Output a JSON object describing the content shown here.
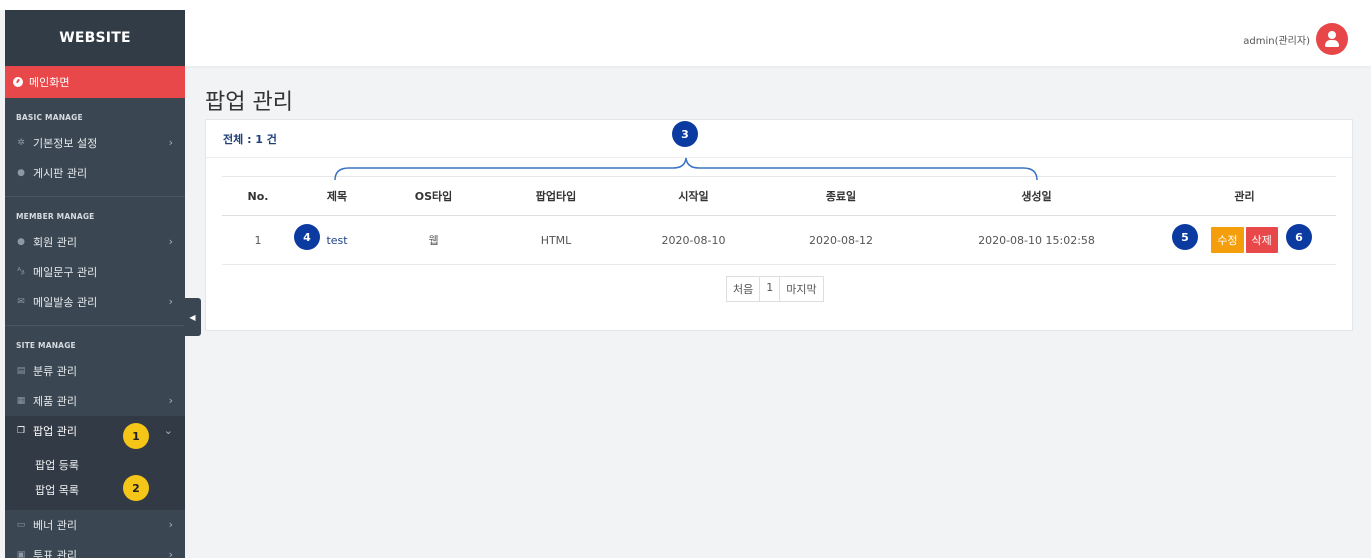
{
  "brand": "WEBSITE",
  "sidebar": {
    "home": "메인화면",
    "sections": [
      {
        "title": "BASIC MANAGE",
        "items": [
          {
            "label": "기본정보 설정",
            "icon": "gear-icon",
            "has_children": true
          },
          {
            "label": "게시판 관리",
            "icon": "chat-icon",
            "has_children": false
          }
        ]
      },
      {
        "title": "MEMBER MANAGE",
        "items": [
          {
            "label": "회원 관리",
            "icon": "user-icon",
            "has_children": true
          },
          {
            "label": "메일문구 관리",
            "icon": "spellcheck-icon",
            "has_children": false
          },
          {
            "label": "메일발송 관리",
            "icon": "envelope-icon",
            "has_children": true
          }
        ]
      },
      {
        "title": "SITE MANAGE",
        "items": [
          {
            "label": "분류 관리",
            "icon": "list-icon",
            "has_children": false
          },
          {
            "label": "제품 관리",
            "icon": "box-icon",
            "has_children": true
          },
          {
            "label": "팝업 관리",
            "icon": "window-icon",
            "has_children": true,
            "active": true,
            "children": [
              "팝업 등록",
              "팝업 목록"
            ]
          },
          {
            "label": "베너 관리",
            "icon": "banner-icon",
            "has_children": true
          },
          {
            "label": "투표 관리",
            "icon": "vote-icon",
            "has_children": true
          }
        ]
      }
    ]
  },
  "header": {
    "user": "admin(관리자)"
  },
  "page": {
    "title": "팝업 관리",
    "total": "전체 : 1 건",
    "columns": [
      "No.",
      "제목",
      "OS타입",
      "팝업타입",
      "시작일",
      "종료일",
      "생성일",
      "관리"
    ],
    "rows": [
      {
        "no": "1",
        "title": "test",
        "os": "웹",
        "type": "HTML",
        "start": "2020-08-10",
        "end": "2020-08-12",
        "created": "2020-08-10 15:02:58",
        "edit": "수정",
        "delete": "삭제"
      }
    ],
    "pager": {
      "first": "처음",
      "current": "1",
      "last": "마지막"
    }
  },
  "annotations": [
    "1",
    "2",
    "3",
    "4",
    "5",
    "6"
  ],
  "colors": {
    "sidebar": "#3a4651",
    "accent_red": "#e84849",
    "edit_orange": "#f59e0b",
    "marker_yellow": "#f5c518",
    "marker_blue": "#0b3aa0"
  }
}
